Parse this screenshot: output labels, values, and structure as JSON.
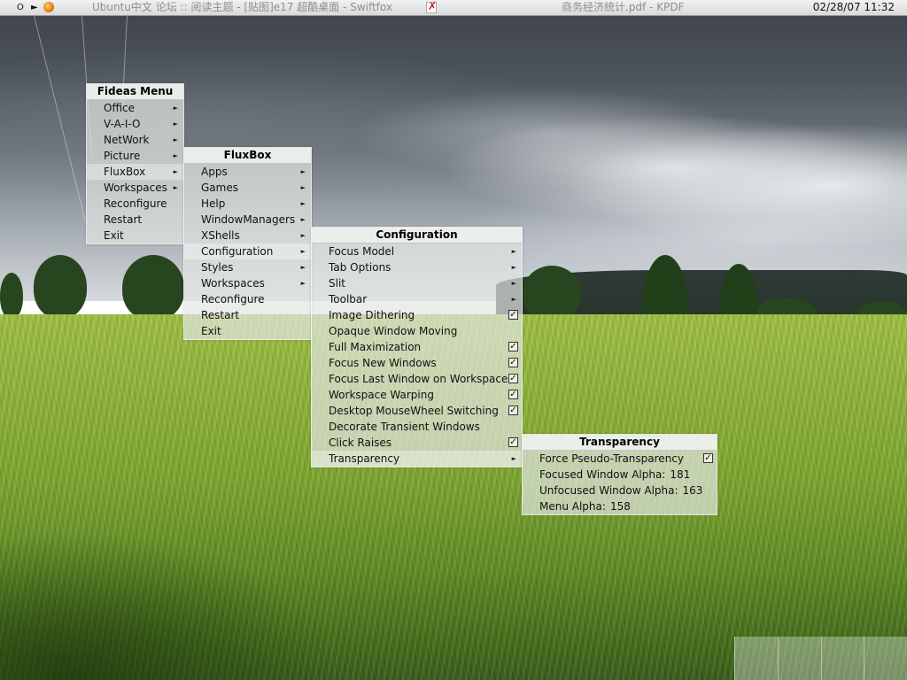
{
  "topbar": {
    "controls": [
      "O",
      "►"
    ],
    "tasks": [
      "Ubuntu中文 论坛 :: 阅读主题 - [贴图]e17 超酷桌面 - Swiftfox",
      "商务经济统计.pdf - KPDF"
    ],
    "clock": "02/28/07 11:32"
  },
  "root_menu": {
    "title": "Fideas Menu",
    "items": [
      {
        "label": "Office",
        "submenu": true
      },
      {
        "label": "V-A-I-O",
        "submenu": true
      },
      {
        "label": "NetWork",
        "submenu": true
      },
      {
        "label": "Picture",
        "submenu": true
      },
      {
        "label": "FluxBox",
        "submenu": true
      },
      {
        "label": "Workspaces",
        "submenu": true
      },
      {
        "label": "Reconfigure",
        "submenu": false
      },
      {
        "label": "Restart",
        "submenu": false
      },
      {
        "label": "Exit",
        "submenu": false
      }
    ]
  },
  "fluxbox_menu": {
    "title": "FluxBox",
    "items": [
      {
        "label": "Apps",
        "submenu": true
      },
      {
        "label": "Games",
        "submenu": true
      },
      {
        "label": "Help",
        "submenu": true
      },
      {
        "label": "WindowManagers",
        "submenu": true
      },
      {
        "label": "XShells",
        "submenu": true
      },
      {
        "label": "Configuration",
        "submenu": true
      },
      {
        "label": "Styles",
        "submenu": true
      },
      {
        "label": "Workspaces",
        "submenu": true
      },
      {
        "label": "Reconfigure",
        "submenu": false
      },
      {
        "label": "Restart",
        "submenu": false
      },
      {
        "label": "Exit",
        "submenu": false
      }
    ]
  },
  "config_menu": {
    "title": "Configuration",
    "items": [
      {
        "label": "Focus Model",
        "submenu": true
      },
      {
        "label": "Tab Options",
        "submenu": true
      },
      {
        "label": "Slit",
        "submenu": true
      },
      {
        "label": "Toolbar",
        "submenu": true
      },
      {
        "label": "Image Dithering",
        "checked": true
      },
      {
        "label": "Opaque Window Moving",
        "checked": false
      },
      {
        "label": "Full Maximization",
        "checked": true
      },
      {
        "label": "Focus New Windows",
        "checked": true
      },
      {
        "label": "Focus Last Window on Workspace",
        "checked": true
      },
      {
        "label": "Workspace Warping",
        "checked": true
      },
      {
        "label": "Desktop MouseWheel Switching",
        "checked": true
      },
      {
        "label": "Decorate Transient Windows",
        "checked": false
      },
      {
        "label": "Click Raises",
        "checked": true
      },
      {
        "label": "Transparency",
        "submenu": true
      }
    ]
  },
  "transparency_menu": {
    "title": "Transparency",
    "items": [
      {
        "label": "Force Pseudo-Transparency",
        "checked": true
      },
      {
        "label": "Focused Window Alpha:",
        "value": "181"
      },
      {
        "label": "Unfocused Window Alpha:",
        "value": "163"
      },
      {
        "label": "Menu Alpha:",
        "value": "158"
      }
    ]
  },
  "glyphs": {
    "arrow": "►",
    "check": "✓"
  },
  "pager": {
    "workspaces": 4
  }
}
